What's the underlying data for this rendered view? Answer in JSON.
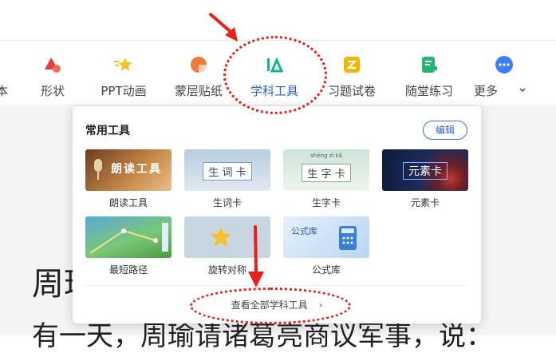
{
  "ribbon": {
    "items": [
      {
        "label": "本",
        "icon": "cut-off-icon",
        "color": "#888888"
      },
      {
        "label": "形状",
        "icon": "shape-icon",
        "color": "#e5403c"
      },
      {
        "label": "PPT动画",
        "icon": "star-animation-icon",
        "color": "#f6c12b"
      },
      {
        "label": "蒙层贴纸",
        "icon": "sticker-icon",
        "color": "#f07a3c"
      },
      {
        "label": "学科工具",
        "icon": "subject-tools-icon",
        "color": "#17b290"
      },
      {
        "label": "习题试卷",
        "icon": "exercise-icon",
        "color": "#f5b400"
      },
      {
        "label": "随堂练习",
        "icon": "practice-icon",
        "color": "#22b573"
      },
      {
        "label": "更多",
        "icon": "more-icon",
        "color": "#3d7ff0"
      }
    ]
  },
  "document": {
    "line1": "周理",
    "line2": "有一天，周瑜请诸葛亮商议军事，说："
  },
  "panel": {
    "title": "常用工具",
    "edit_label": "编辑",
    "tools": [
      {
        "label": "朗读工具",
        "thumb_text": "朗读工具"
      },
      {
        "label": "生词卡",
        "thumb_text": "生 词 卡"
      },
      {
        "label": "生字卡",
        "thumb_text": "生 字 卡",
        "pinyin": "shēng zì kǎ"
      },
      {
        "label": "元素卡",
        "thumb_text": "元素卡"
      },
      {
        "label": "最短路径",
        "thumb_text": ""
      },
      {
        "label": "旋转对称",
        "thumb_text": ""
      },
      {
        "label": "公式库",
        "thumb_text": "公式库"
      }
    ],
    "view_all_label": "查看全部学科工具",
    "view_all_chevron": "›"
  },
  "colors": {
    "accent": "#3d6fd8",
    "annotation_red": "#e8201c"
  }
}
